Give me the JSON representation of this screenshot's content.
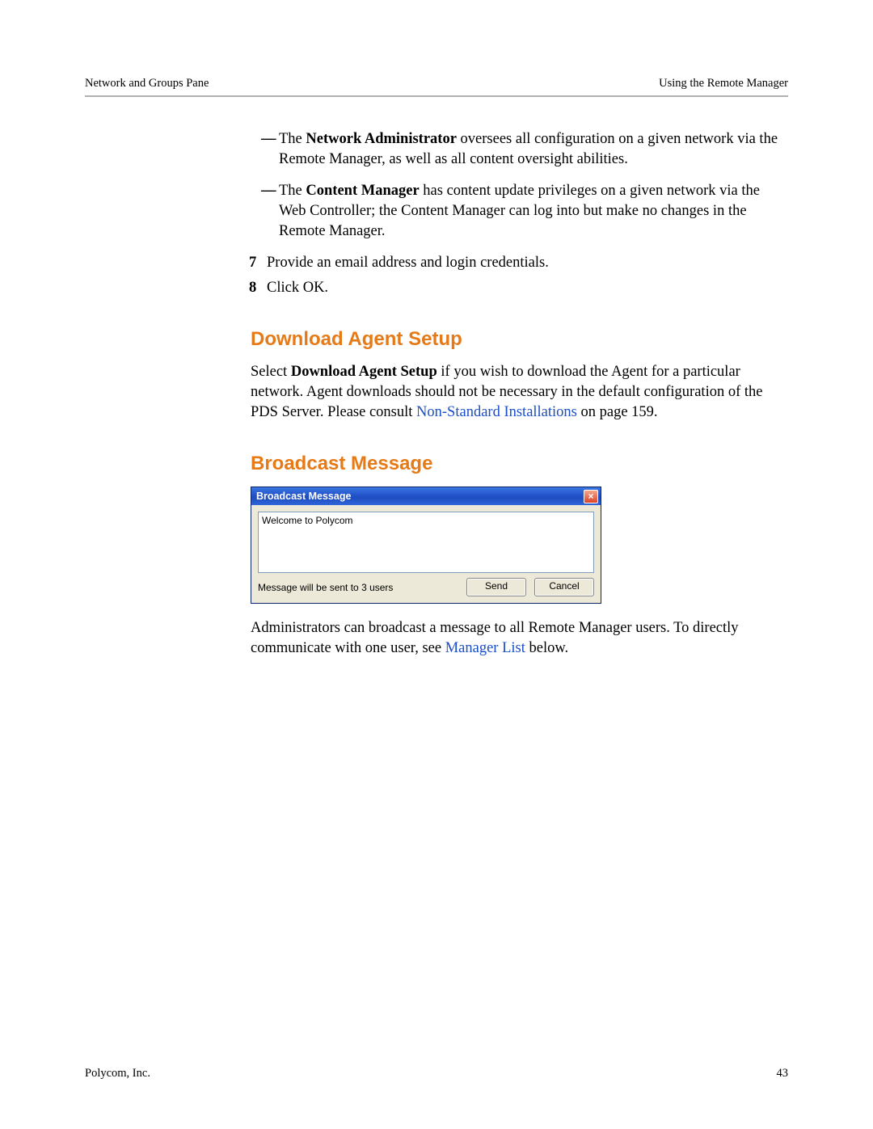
{
  "header": {
    "left": "Network and Groups Pane",
    "right": "Using the Remote Manager"
  },
  "bullets": {
    "b1_prefix": "The ",
    "b1_bold": "Network Administrator",
    "b1_rest": " oversees all configuration on a given network via the Remote Manager, as well as all content oversight abilities.",
    "b2_prefix": "The ",
    "b2_bold": "Content Manager",
    "b2_rest": " has content update privileges on a given network via the Web Controller; the Content Manager can log into but make no changes in the Remote Manager."
  },
  "steps": {
    "n7": "7",
    "t7": "Provide an email address and login credentials.",
    "n8": "8",
    "t8": "Click OK."
  },
  "section1": {
    "title": "Download Agent Setup",
    "p_pre": "Select ",
    "p_bold": "Download Agent Setup",
    "p_mid": " if you wish to download the Agent for a particular network. Agent downloads should not be necessary in the default configuration of the PDS Server. Please consult ",
    "p_link": "Non-Standard Installations",
    "p_post": " on page 159."
  },
  "section2": {
    "title": "Broadcast Message",
    "p_pre": "Administrators can broadcast a message to all Remote Manager users. To directly communicate with one user, see ",
    "p_link": "Manager List",
    "p_post": " below."
  },
  "dialog": {
    "title": "Broadcast Message",
    "close_glyph": "×",
    "textarea_value": "Welcome to Polycom",
    "status_text": "Message will be sent to 3 users",
    "send_label": "Send",
    "cancel_label": "Cancel"
  },
  "footer": {
    "left": "Polycom, Inc.",
    "right": "43"
  }
}
